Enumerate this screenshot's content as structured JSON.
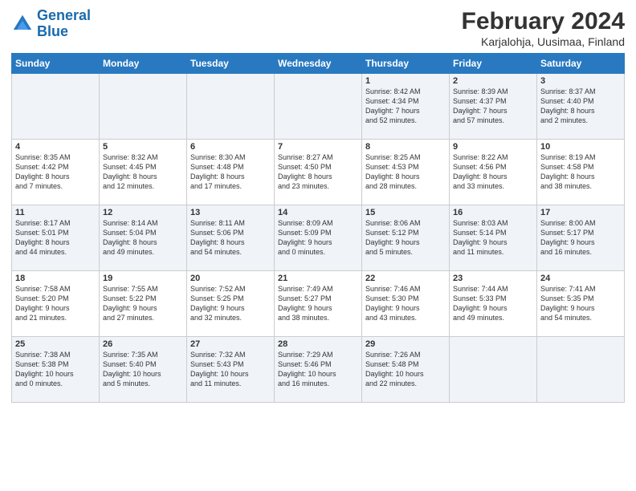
{
  "header": {
    "logo_line1": "General",
    "logo_line2": "Blue",
    "title": "February 2024",
    "subtitle": "Karjalohja, Uusimaa, Finland"
  },
  "days_of_week": [
    "Sunday",
    "Monday",
    "Tuesday",
    "Wednesday",
    "Thursday",
    "Friday",
    "Saturday"
  ],
  "weeks": [
    [
      {
        "day": "",
        "text": ""
      },
      {
        "day": "",
        "text": ""
      },
      {
        "day": "",
        "text": ""
      },
      {
        "day": "",
        "text": ""
      },
      {
        "day": "1",
        "text": "Sunrise: 8:42 AM\nSunset: 4:34 PM\nDaylight: 7 hours\nand 52 minutes."
      },
      {
        "day": "2",
        "text": "Sunrise: 8:39 AM\nSunset: 4:37 PM\nDaylight: 7 hours\nand 57 minutes."
      },
      {
        "day": "3",
        "text": "Sunrise: 8:37 AM\nSunset: 4:40 PM\nDaylight: 8 hours\nand 2 minutes."
      }
    ],
    [
      {
        "day": "4",
        "text": "Sunrise: 8:35 AM\nSunset: 4:42 PM\nDaylight: 8 hours\nand 7 minutes."
      },
      {
        "day": "5",
        "text": "Sunrise: 8:32 AM\nSunset: 4:45 PM\nDaylight: 8 hours\nand 12 minutes."
      },
      {
        "day": "6",
        "text": "Sunrise: 8:30 AM\nSunset: 4:48 PM\nDaylight: 8 hours\nand 17 minutes."
      },
      {
        "day": "7",
        "text": "Sunrise: 8:27 AM\nSunset: 4:50 PM\nDaylight: 8 hours\nand 23 minutes."
      },
      {
        "day": "8",
        "text": "Sunrise: 8:25 AM\nSunset: 4:53 PM\nDaylight: 8 hours\nand 28 minutes."
      },
      {
        "day": "9",
        "text": "Sunrise: 8:22 AM\nSunset: 4:56 PM\nDaylight: 8 hours\nand 33 minutes."
      },
      {
        "day": "10",
        "text": "Sunrise: 8:19 AM\nSunset: 4:58 PM\nDaylight: 8 hours\nand 38 minutes."
      }
    ],
    [
      {
        "day": "11",
        "text": "Sunrise: 8:17 AM\nSunset: 5:01 PM\nDaylight: 8 hours\nand 44 minutes."
      },
      {
        "day": "12",
        "text": "Sunrise: 8:14 AM\nSunset: 5:04 PM\nDaylight: 8 hours\nand 49 minutes."
      },
      {
        "day": "13",
        "text": "Sunrise: 8:11 AM\nSunset: 5:06 PM\nDaylight: 8 hours\nand 54 minutes."
      },
      {
        "day": "14",
        "text": "Sunrise: 8:09 AM\nSunset: 5:09 PM\nDaylight: 9 hours\nand 0 minutes."
      },
      {
        "day": "15",
        "text": "Sunrise: 8:06 AM\nSunset: 5:12 PM\nDaylight: 9 hours\nand 5 minutes."
      },
      {
        "day": "16",
        "text": "Sunrise: 8:03 AM\nSunset: 5:14 PM\nDaylight: 9 hours\nand 11 minutes."
      },
      {
        "day": "17",
        "text": "Sunrise: 8:00 AM\nSunset: 5:17 PM\nDaylight: 9 hours\nand 16 minutes."
      }
    ],
    [
      {
        "day": "18",
        "text": "Sunrise: 7:58 AM\nSunset: 5:20 PM\nDaylight: 9 hours\nand 21 minutes."
      },
      {
        "day": "19",
        "text": "Sunrise: 7:55 AM\nSunset: 5:22 PM\nDaylight: 9 hours\nand 27 minutes."
      },
      {
        "day": "20",
        "text": "Sunrise: 7:52 AM\nSunset: 5:25 PM\nDaylight: 9 hours\nand 32 minutes."
      },
      {
        "day": "21",
        "text": "Sunrise: 7:49 AM\nSunset: 5:27 PM\nDaylight: 9 hours\nand 38 minutes."
      },
      {
        "day": "22",
        "text": "Sunrise: 7:46 AM\nSunset: 5:30 PM\nDaylight: 9 hours\nand 43 minutes."
      },
      {
        "day": "23",
        "text": "Sunrise: 7:44 AM\nSunset: 5:33 PM\nDaylight: 9 hours\nand 49 minutes."
      },
      {
        "day": "24",
        "text": "Sunrise: 7:41 AM\nSunset: 5:35 PM\nDaylight: 9 hours\nand 54 minutes."
      }
    ],
    [
      {
        "day": "25",
        "text": "Sunrise: 7:38 AM\nSunset: 5:38 PM\nDaylight: 10 hours\nand 0 minutes."
      },
      {
        "day": "26",
        "text": "Sunrise: 7:35 AM\nSunset: 5:40 PM\nDaylight: 10 hours\nand 5 minutes."
      },
      {
        "day": "27",
        "text": "Sunrise: 7:32 AM\nSunset: 5:43 PM\nDaylight: 10 hours\nand 11 minutes."
      },
      {
        "day": "28",
        "text": "Sunrise: 7:29 AM\nSunset: 5:46 PM\nDaylight: 10 hours\nand 16 minutes."
      },
      {
        "day": "29",
        "text": "Sunrise: 7:26 AM\nSunset: 5:48 PM\nDaylight: 10 hours\nand 22 minutes."
      },
      {
        "day": "",
        "text": ""
      },
      {
        "day": "",
        "text": ""
      }
    ]
  ]
}
